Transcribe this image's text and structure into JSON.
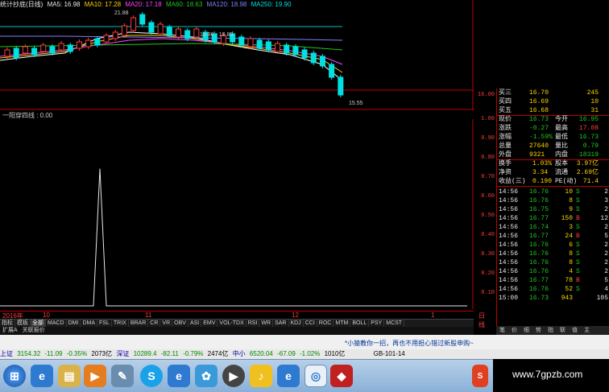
{
  "legend": {
    "title": "统计抄底(日线)",
    "ma5": "MA5: 16.98",
    "ma10": "MA10: 17.28",
    "ma20": "MA20: 17.18",
    "ma60": "MA60: 18.63",
    "ma120": "MA120: 18.98",
    "ma250": "MA250: 19.90"
  },
  "main_annotations": {
    "high": "21.88",
    "mid": "18.86 - 18.85",
    "low": "15.55",
    "axis_16": "16.00"
  },
  "sub_chart": {
    "title": "一阳穿四线 : 0.00",
    "axis": [
      "1.00",
      "0.90",
      "0.80",
      "0.70",
      "0.60",
      "0.50",
      "0.40",
      "0.30",
      "0.20",
      "0.10"
    ],
    "spike_fraction": 0.73
  },
  "time_axis": [
    "2016年",
    "10",
    "11",
    "12",
    "1"
  ],
  "time_axis_right": "日线",
  "tabs": [
    "指标",
    "模板",
    "全部",
    "MACD",
    "DMI",
    "DMA",
    "FSL",
    "TRIX",
    "BRAR",
    "CR",
    "VR",
    "OBV",
    "ASI",
    "EMV",
    "VOL-TDX",
    "RSI",
    "WR",
    "SAR",
    "KDJ",
    "CCI",
    "ROC",
    "MTM",
    "BOLL",
    "PSY",
    "MCST"
  ],
  "tabs2": [
    "扩展A",
    "关联报价"
  ],
  "quotes": {
    "asks": [
      {
        "label": "买三",
        "price": "16.70",
        "vol": "245"
      },
      {
        "label": "买四",
        "price": "16.69",
        "vol": "10"
      },
      {
        "label": "买五",
        "price": "16.68",
        "vol": "31"
      }
    ],
    "info": [
      {
        "l1": "现价",
        "v1": "16.73",
        "l2": "今开",
        "v2": "16.95"
      },
      {
        "l1": "涨跌",
        "v1": "-0.27",
        "l2": "最高",
        "v2": "17.08"
      },
      {
        "l1": "涨幅",
        "v1": "-1.59%",
        "l2": "最低",
        "v2": "16.73"
      },
      {
        "l1": "总量",
        "v1": "27640",
        "l2": "量比",
        "v2": "0.79"
      },
      {
        "l1": "外盘",
        "v1": "9321",
        "l2": "内盘",
        "v2": "18319"
      }
    ],
    "info2": [
      {
        "l1": "换手",
        "v1": "1.03%",
        "l2": "股本",
        "v2": "3.97亿"
      },
      {
        "l1": "净资",
        "v1": "3.34",
        "l2": "流通",
        "v2": "2.69亿"
      },
      {
        "l1": "收益(三)",
        "v1": "0.190",
        "l2": "PE(动)",
        "v2": "71.4"
      }
    ],
    "ticks": [
      {
        "t": "14:56",
        "p": "16.76",
        "v": "10",
        "s": "S",
        "n": "2"
      },
      {
        "t": "14:56",
        "p": "16.76",
        "v": "8",
        "s": "S",
        "n": "3"
      },
      {
        "t": "14:56",
        "p": "16.75",
        "v": "9",
        "s": "S",
        "n": "2"
      },
      {
        "t": "14:56",
        "p": "16.77",
        "v": "150",
        "s": "B",
        "n": "12"
      },
      {
        "t": "14:56",
        "p": "16.74",
        "v": "3",
        "s": "S",
        "n": "2"
      },
      {
        "t": "14:56",
        "p": "16.77",
        "v": "24",
        "s": "B",
        "n": "5"
      },
      {
        "t": "14:56",
        "p": "16.76",
        "v": "6",
        "s": "S",
        "n": "2"
      },
      {
        "t": "14:56",
        "p": "16.76",
        "v": "8",
        "s": "S",
        "n": "2"
      },
      {
        "t": "14:56",
        "p": "16.76",
        "v": "8",
        "s": "S",
        "n": "2"
      },
      {
        "t": "14:56",
        "p": "16.76",
        "v": "4",
        "s": "S",
        "n": "2"
      },
      {
        "t": "14:56",
        "p": "16.77",
        "v": "78",
        "s": "B",
        "n": "5"
      },
      {
        "t": "14:56",
        "p": "16.76",
        "v": "52",
        "s": "S",
        "n": "4"
      },
      {
        "t": "15:00",
        "p": "16.73",
        "v": "943",
        "s": "",
        "n": "105"
      }
    ],
    "tabs": [
      "笔",
      "价",
      "细",
      "势",
      "指",
      "联",
      "值",
      "主"
    ]
  },
  "message": "*小猿教你一招，再也不用担心错过新股申购~",
  "index_bar": {
    "sh_label": "上证",
    "sh_val": "3154.32",
    "sh_chg": "-11.09",
    "sh_pct": "-0.35%",
    "sh_amt": "2073亿",
    "sz_label": "深证",
    "sz_val": "10289.4",
    "sz_chg": "-82.11",
    "sz_pct": "-0.79%",
    "sz_amt": "2474亿",
    "zx_label": "中小",
    "zx_val": "6520.04",
    "zx_chg": "-67.09",
    "zx_pct": "-1.02%",
    "zx_amt": "1010亿",
    "code": "GB-101-14"
  },
  "watermark": "www.7gpzb.com",
  "colors": {
    "up": "#ff3b3b",
    "down": "#1ec81e",
    "background": "#000000"
  }
}
